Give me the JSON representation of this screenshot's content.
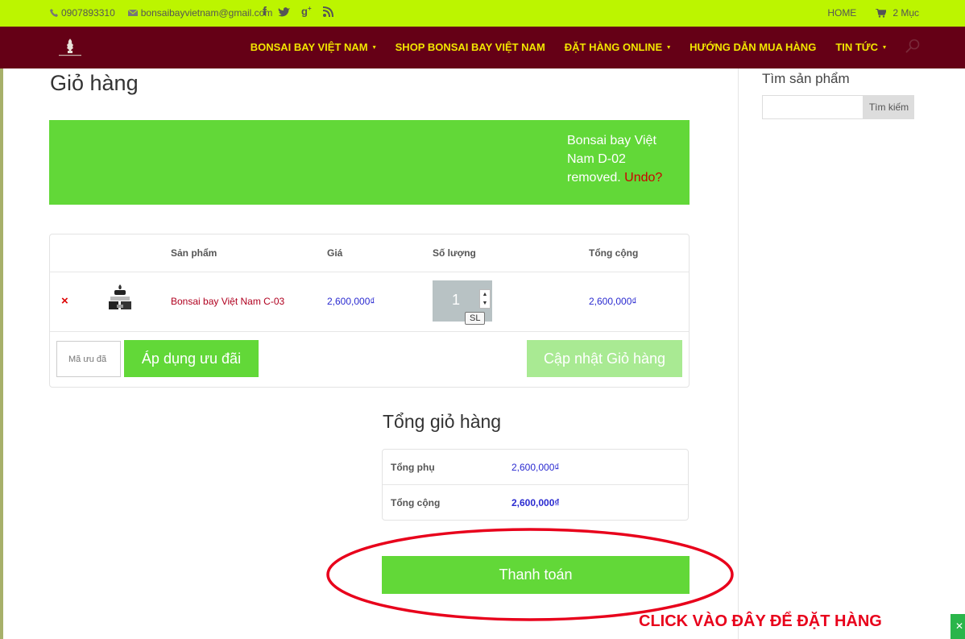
{
  "topbar": {
    "phone": "0907893310",
    "email": "bonsaibayvietnam@gmail.com",
    "social_icons": [
      "facebook-icon",
      "twitter-icon",
      "google-plus-icon",
      "rss-icon"
    ],
    "home_label": "HOME",
    "cart_label": "2 Mục"
  },
  "nav": {
    "items": [
      {
        "label": "BONSAI BAY VIỆT NAM",
        "has_dropdown": true
      },
      {
        "label": "SHOP BONSAI BAY VIỆT NAM",
        "has_dropdown": false
      },
      {
        "label": "ĐẶT HÀNG ONLINE",
        "has_dropdown": true
      },
      {
        "label": "HƯỚNG DẪN MUA HÀNG",
        "has_dropdown": false
      },
      {
        "label": "TIN TỨC",
        "has_dropdown": true
      }
    ]
  },
  "page": {
    "title": "Giỏ hàng"
  },
  "notice": {
    "message": "Bonsai bay Việt Nam D-02 removed.",
    "undo_label": "Undo?"
  },
  "cart": {
    "headers": {
      "product": "Sản phẩm",
      "price": "Giá",
      "quantity": "Số lượng",
      "total": "Tổng cộng"
    },
    "items": [
      {
        "remove_symbol": "×",
        "name": "Bonsai bay Việt Nam C-03",
        "price": "2,600,000₫",
        "quantity": "1",
        "quantity_tooltip": "SL",
        "total": "2,600,000₫"
      }
    ],
    "coupon_placeholder": "Mã ưu đã",
    "apply_coupon_label": "Áp dụng ưu đãi",
    "update_cart_label": "Cập nhật Giỏ hàng"
  },
  "totals": {
    "title": "Tổng giỏ hàng",
    "subtotal_label": "Tổng phụ",
    "subtotal_value": "2,600,000₫",
    "total_label": "Tổng cộng",
    "total_value": "2,600,000₫",
    "checkout_label": "Thanh toán"
  },
  "annotation": {
    "text": "CLICK VÀO ĐÂY ĐỂ ĐẶT HÀNG",
    "color": "#e8001b"
  },
  "sidebar": {
    "search_title": "Tìm sản phẩm",
    "search_button_label": "Tìm kiếm"
  },
  "colors": {
    "topbar": "#bcf500",
    "nav": "#650016",
    "nav_text": "#f2e500",
    "accent_green": "#62d838",
    "price_blue": "#2a2ad0"
  }
}
